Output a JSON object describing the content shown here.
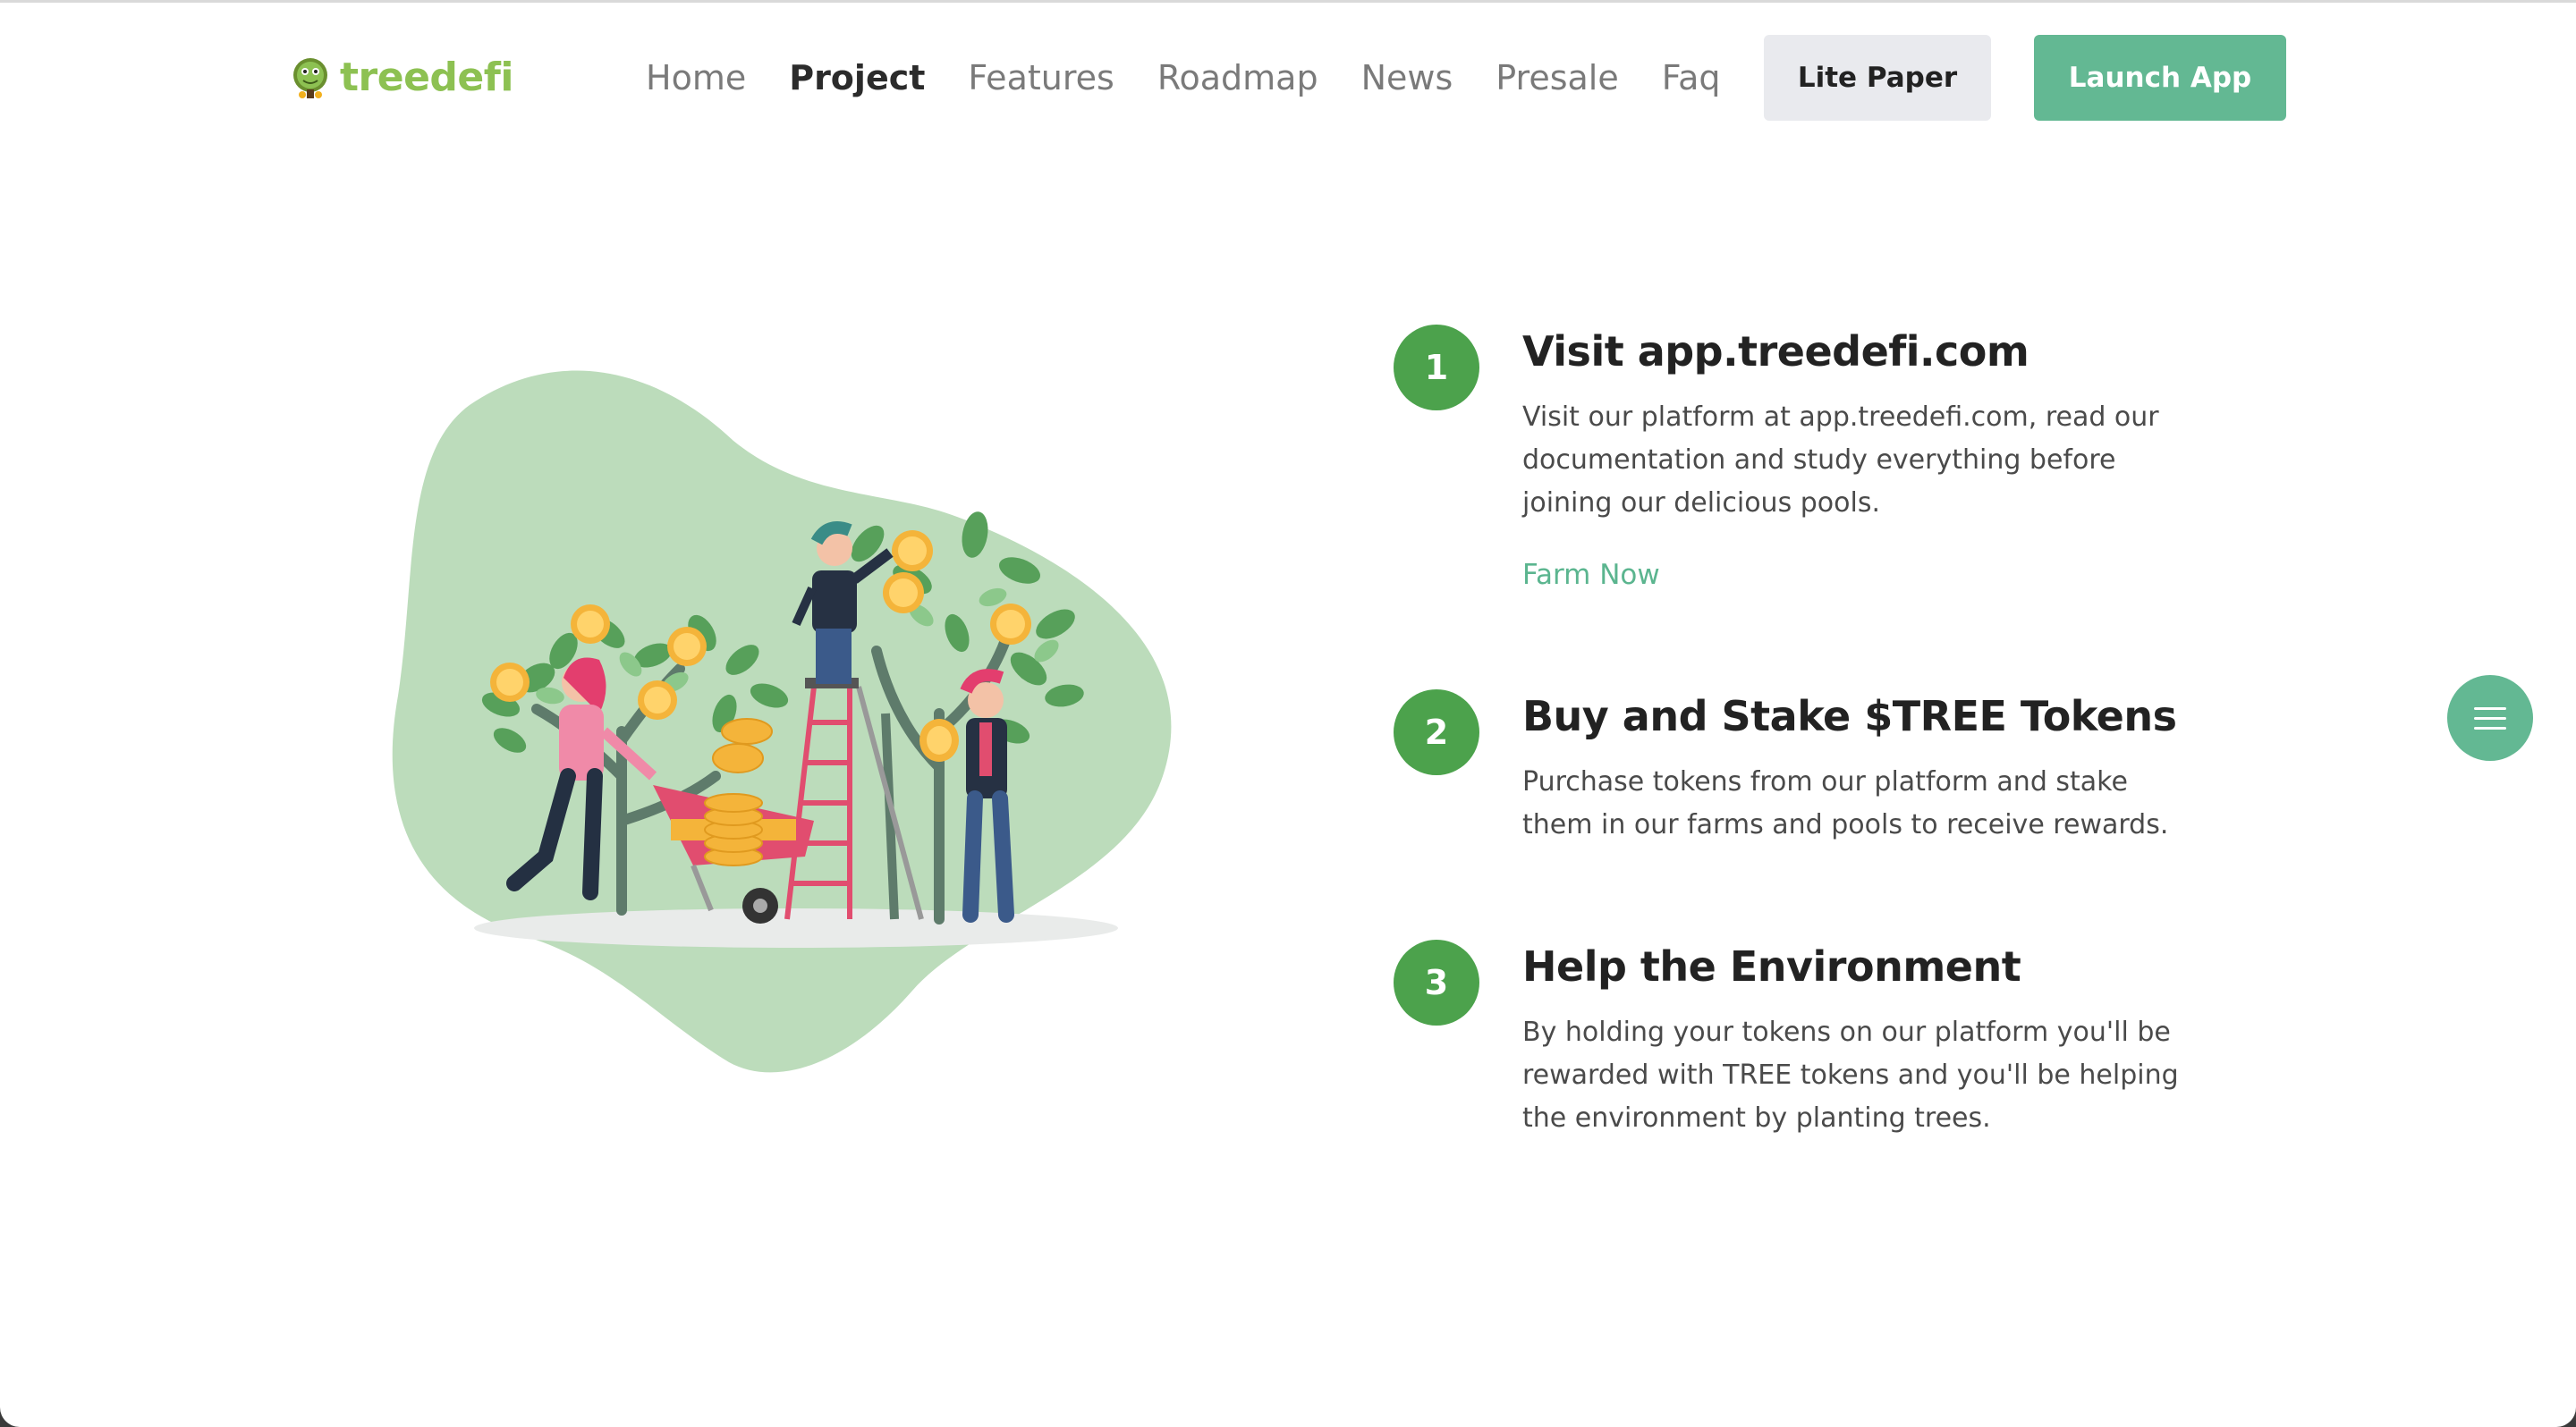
{
  "brand": {
    "name": "treedefi"
  },
  "nav": {
    "items": [
      {
        "label": "Home",
        "active": false
      },
      {
        "label": "Project",
        "active": true
      },
      {
        "label": "Features",
        "active": false
      },
      {
        "label": "Roadmap",
        "active": false
      },
      {
        "label": "News",
        "active": false
      },
      {
        "label": "Presale",
        "active": false
      },
      {
        "label": "Faq",
        "active": false
      }
    ],
    "lite_paper_label": "Lite Paper",
    "launch_app_label": "Launch App"
  },
  "illustration": {
    "icon": "money-tree-illustration"
  },
  "steps": [
    {
      "number": "1",
      "title": "Visit app.treedefi.com",
      "description": "Visit our platform at app.treedefi.com, read our documentation and study everything before joining our delicious pools.",
      "link_label": "Farm Now"
    },
    {
      "number": "2",
      "title": "Buy and Stake $TREE Tokens",
      "description": "Purchase tokens from our platform and stake them in our farms and pools to receive rewards."
    },
    {
      "number": "3",
      "title": "Help the Environment",
      "description": "By holding your tokens on our platform you'll be rewarded with TREE tokens and you'll be helping the environment by planting trees."
    }
  ],
  "floating_menu": {
    "icon": "menu-icon"
  },
  "colors": {
    "brand_green": "#8dc152",
    "accent_teal": "#63b893",
    "step_green": "#4ca24c",
    "blob_green": "#bcdcbb"
  }
}
